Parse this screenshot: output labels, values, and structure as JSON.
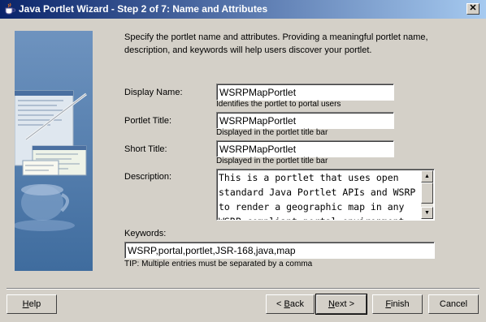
{
  "window": {
    "title": "Java Portlet Wizard - Step 2 of 7: Name and Attributes",
    "close_glyph": "✕"
  },
  "intro_text": "Specify the portlet name and attributes. Providing a meaningful portlet name, description, and keywords will help users discover your portlet.",
  "form": {
    "display_name": {
      "label": "Display Name:",
      "value": "WSRPMapPortlet",
      "hint": "Identifies the portlet to portal users"
    },
    "portlet_title": {
      "label": "Portlet Title:",
      "value": "WSRPMapPortlet",
      "hint": "Displayed in the portlet title bar"
    },
    "short_title": {
      "label": "Short Title:",
      "value": "WSRPMapPortlet",
      "hint": "Displayed in the portlet title bar"
    },
    "description": {
      "label": "Description:",
      "value": "This is a portlet that uses open standard Java Portlet APIs and WSRP to render a geographic map in any WSRP-compliant portal environment."
    },
    "keywords": {
      "label": "Keywords:",
      "value": "WSRP,portal,portlet,JSR-168,java,map",
      "tip": "TIP: Multiple entries must be separated by a comma"
    }
  },
  "buttons": {
    "help": {
      "mnemonic": "H",
      "rest": "elp"
    },
    "back": {
      "prefix": "< ",
      "mnemonic": "B",
      "rest": "ack"
    },
    "next": {
      "mnemonic": "N",
      "rest": "ext >"
    },
    "finish": {
      "mnemonic": "F",
      "rest": "inish"
    },
    "cancel": "Cancel"
  },
  "colors": {
    "title_gradient_start": "#0a246a",
    "title_gradient_end": "#a6caf0",
    "dialog_background": "#d4d0c8",
    "side_panel": "#5b82b1"
  },
  "icons": {
    "title": "java-coffee-cup-icon",
    "side_art": "wizard-illustration-coffee-cup"
  }
}
